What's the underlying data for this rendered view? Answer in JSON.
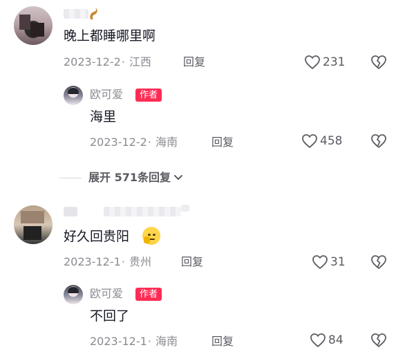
{
  "comments": [
    {
      "text": "晚上都睡哪里啊",
      "date": "2023-12-2",
      "location": "江西",
      "reply_label": "回复",
      "likes": "231",
      "reply": {
        "author": "欧可爱",
        "badge": "作者",
        "text": "海里",
        "date": "2023-12-2",
        "location": "海南",
        "reply_label": "回复",
        "likes": "458"
      },
      "expand_label": "展开 571条回复"
    },
    {
      "text": "好久回贵阳",
      "date": "2023-12-1",
      "location": "贵州",
      "reply_label": "回复",
      "likes": "31",
      "reply": {
        "author": "欧可爱",
        "badge": "作者",
        "text": "不回了",
        "date": "2023-12-1",
        "location": "海南",
        "reply_label": "回复",
        "likes": "84"
      }
    }
  ],
  "separator": "·",
  "icons": {
    "like": "heart-outline-icon",
    "dislike": "broken-heart-icon",
    "expand": "chevron-down-icon",
    "emoji": "thinking-face-emoji"
  },
  "colors": {
    "badge": "#fe2c55",
    "text_primary": "#161823",
    "text_secondary": "#8a8b91"
  }
}
